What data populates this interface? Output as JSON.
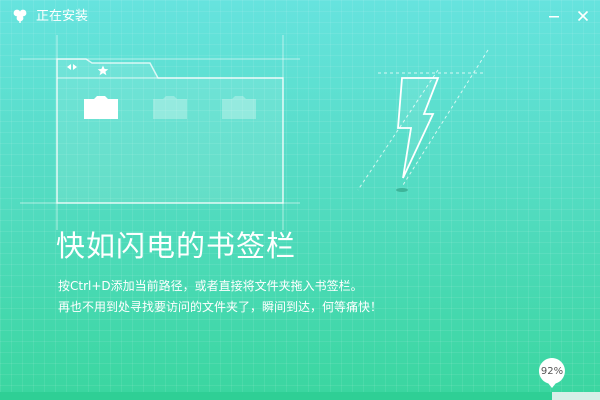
{
  "window": {
    "title": "正在安装",
    "minimize_label": "—",
    "close_label": "✕"
  },
  "icons": {
    "app": "clover-logo-icon",
    "folder_tab_arrows": "code-arrows-icon",
    "folder_tab_star": "star-icon",
    "folders": "folder-icon",
    "lightning": "lightning-icon"
  },
  "main": {
    "headline": "快如闪电的书签栏",
    "description_line1": "按Ctrl+D添加当前路径，或者直接将文件夹拖入书签栏。",
    "description_line2": "再也不用到处寻找要访问的文件夹了，瞬间到达，何等痛快！"
  },
  "progress": {
    "percent": 92,
    "label": "92%"
  },
  "colors": {
    "bg_top": "#66e3de",
    "bg_bottom": "#3ad69f",
    "progress_fill": "#2fcf95",
    "progress_track": "#d8efe8"
  }
}
